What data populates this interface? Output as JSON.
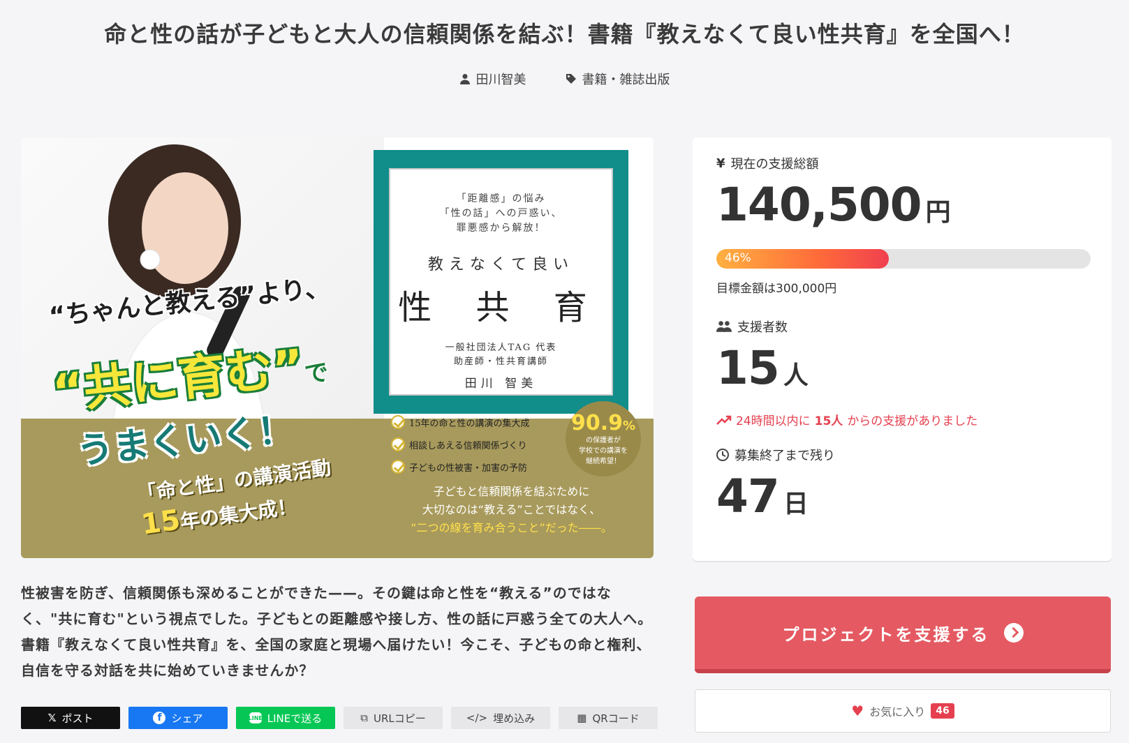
{
  "page": {
    "title": "命と性の話が子どもと大人の信頼関係を結ぶ！書籍『教えなくて良い性共育』を全国へ！",
    "author": "田川智美",
    "category": "書籍・雑誌出版"
  },
  "hero": {
    "book": {
      "subtitle_lines": [
        "「距離感」の悩み",
        "「性の話」への戸惑い、",
        "罪悪感から解放！"
      ],
      "title_top": "教えなくて良い",
      "title_main": "性 共 育",
      "author_lines": [
        "一般社団法人TAG 代表",
        "助産師・性共育講師"
      ],
      "author_name": "田川 智美"
    },
    "tagline1": "“ちゃんと教える”より、",
    "tagline2": "“共に育む”",
    "tagline2_suffix": "で",
    "tagline3": "うまくいく！",
    "tagline4_line1": "「命と性」の講演活動",
    "tagline4_num": "15",
    "tagline4_line2": "年の集大成！",
    "checks": [
      "15年の命と性の講演の集大成",
      "相談しあえる信頼関係づくり",
      "子どもの性被害・加害の予防"
    ],
    "stat_value": "90.9",
    "stat_unit": "%",
    "stat_caption": [
      "の保護者が",
      "学校での講演を",
      "継続希望！"
    ],
    "olive_lines": [
      "子どもと信頼関係を結ぶために",
      "大切なのは“教える”ことではなく、",
      "“二つの線を育み合うこと”だった――。"
    ]
  },
  "stats": {
    "amount_label": "現在の支援総額",
    "amount_value": "140,500",
    "amount_unit": "円",
    "progress_percent": 46,
    "progress_label": "46%",
    "goal_text": "目標金額は300,000円",
    "supporters_label": "支援者数",
    "supporters_value": "15",
    "supporters_unit": "人",
    "recent_prefix": "24時間以内に",
    "recent_count": "15人",
    "recent_suffix": "からの支援がありました",
    "remaining_label": "募集終了まで残り",
    "remaining_value": "47",
    "remaining_unit": "日"
  },
  "actions": {
    "support_label": "プロジェクトを支援する",
    "favorite_label": "お気に入り",
    "favorite_count": "46"
  },
  "description": "性被害を防ぎ、信頼関係も深めることができた——。その鍵は命と性を“教える”のではなく、\"共に育む\"という視点でした。子どもとの距離感や接し方、性の話に戸惑う全ての大人へ。書籍『教えなくて良い性共育』を、全国の家庭と現場へ届けたい！今こそ、子どもの命と権利、自信を守る対話を共に始めていきませんか？",
  "share": {
    "x": "ポスト",
    "facebook": "シェア",
    "line": "LINEで送る",
    "url": "URLコピー",
    "embed": "埋め込み",
    "qr": "QRコード"
  },
  "colors": {
    "accent": "#e55a62",
    "alert": "#e5404f",
    "teal": "#118d8a",
    "olive": "#a89a5c"
  }
}
